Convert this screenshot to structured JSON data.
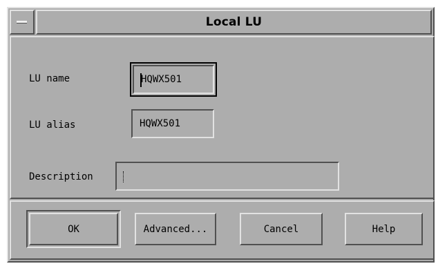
{
  "window": {
    "title": "Local LU",
    "background": "#adadad"
  },
  "form": {
    "lu_name": {
      "label": "LU name",
      "value": "HQWX501"
    },
    "lu_alias": {
      "label": "LU alias",
      "value": "HQWX501"
    },
    "description": {
      "label": "Description",
      "value": ""
    }
  },
  "buttons": {
    "ok": "OK",
    "advanced": "Advanced...",
    "cancel": "Cancel",
    "help": "Help"
  },
  "icons": {
    "window_menu": "window-menu-icon"
  }
}
